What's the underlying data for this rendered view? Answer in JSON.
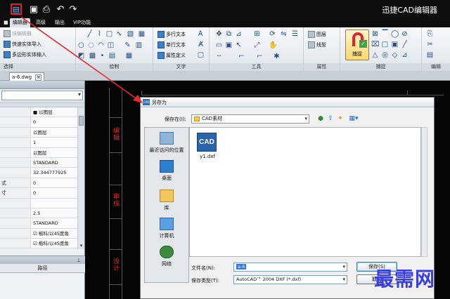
{
  "app": {
    "title": "迅捷CAD编辑器"
  },
  "quick_access": [
    "save-icon",
    "save-as-icon",
    "print-icon",
    "undo-icon",
    "redo-icon"
  ],
  "tabs": [
    {
      "label": "编辑器",
      "active": true
    },
    {
      "label": "高级",
      "active": false
    },
    {
      "label": "输出",
      "active": false
    },
    {
      "label": "VIP功能",
      "active": false
    }
  ],
  "ribbon": {
    "select": {
      "label": "选择",
      "items": [
        "块编辑器",
        "快速实体导入",
        "多边形实体输入"
      ]
    },
    "draw": {
      "label": "绘制"
    },
    "text": {
      "label": "文字",
      "items": [
        "多行文本",
        "单行文本",
        "属性定义"
      ]
    },
    "tools": {
      "label": "工具"
    },
    "props": {
      "label": "属性",
      "items": [
        "图层",
        "线型"
      ]
    },
    "snap": {
      "label": "捕捉",
      "button": "捕捉"
    },
    "edit": {
      "label": "编辑"
    }
  },
  "document": {
    "tab": "a-6.dwg"
  },
  "properties_panel": {
    "rows": [
      {
        "key": "",
        "value": "■ 以图层"
      },
      {
        "key": "",
        "value": "0"
      },
      {
        "key": "",
        "value": "以图层"
      },
      {
        "key": "",
        "value": "1"
      },
      {
        "key": "",
        "value": "以图层"
      },
      {
        "key": "",
        "value": "STANDARD"
      },
      {
        "key": "",
        "value": "32.344777925"
      },
      {
        "key": "式",
        "value": "0"
      },
      {
        "key": "寸",
        "value": "0"
      },
      {
        "key": "",
        "value": ""
      },
      {
        "key": "",
        "value": "2.5"
      },
      {
        "key": "",
        "value": "STANDARD"
      },
      {
        "key": "",
        "value": "☑ 楷科/以45度角"
      },
      {
        "key": "",
        "value": "☑ 楷科/以45度角"
      }
    ],
    "path_header": "路径"
  },
  "canvas": {
    "labels": [
      "编辑",
      "审核",
      "设计"
    ]
  },
  "dialog": {
    "title": "另存为",
    "save_in_label": "保存在(I):",
    "save_in_value": "CAD素材",
    "places": [
      "最近访问的位置",
      "桌面",
      "库",
      "计算机",
      "网络"
    ],
    "file": {
      "icon_text": "CAD",
      "name": "y1.dxf"
    },
    "filename_label": "文件名(N):",
    "filename_value": "a-6",
    "filetype_label": "保存类型(T):",
    "filetype_value": "AutoCAD™ 2004 DXF (*.dxf)",
    "save_button": "保存(S)",
    "cancel_button": "取消"
  },
  "watermark": "最需网",
  "colors": {
    "accent_red": "#d81e1e",
    "canvas_bg": "#050505",
    "titlebar": "#0e0e0e",
    "watermark": "#3a3de0"
  }
}
